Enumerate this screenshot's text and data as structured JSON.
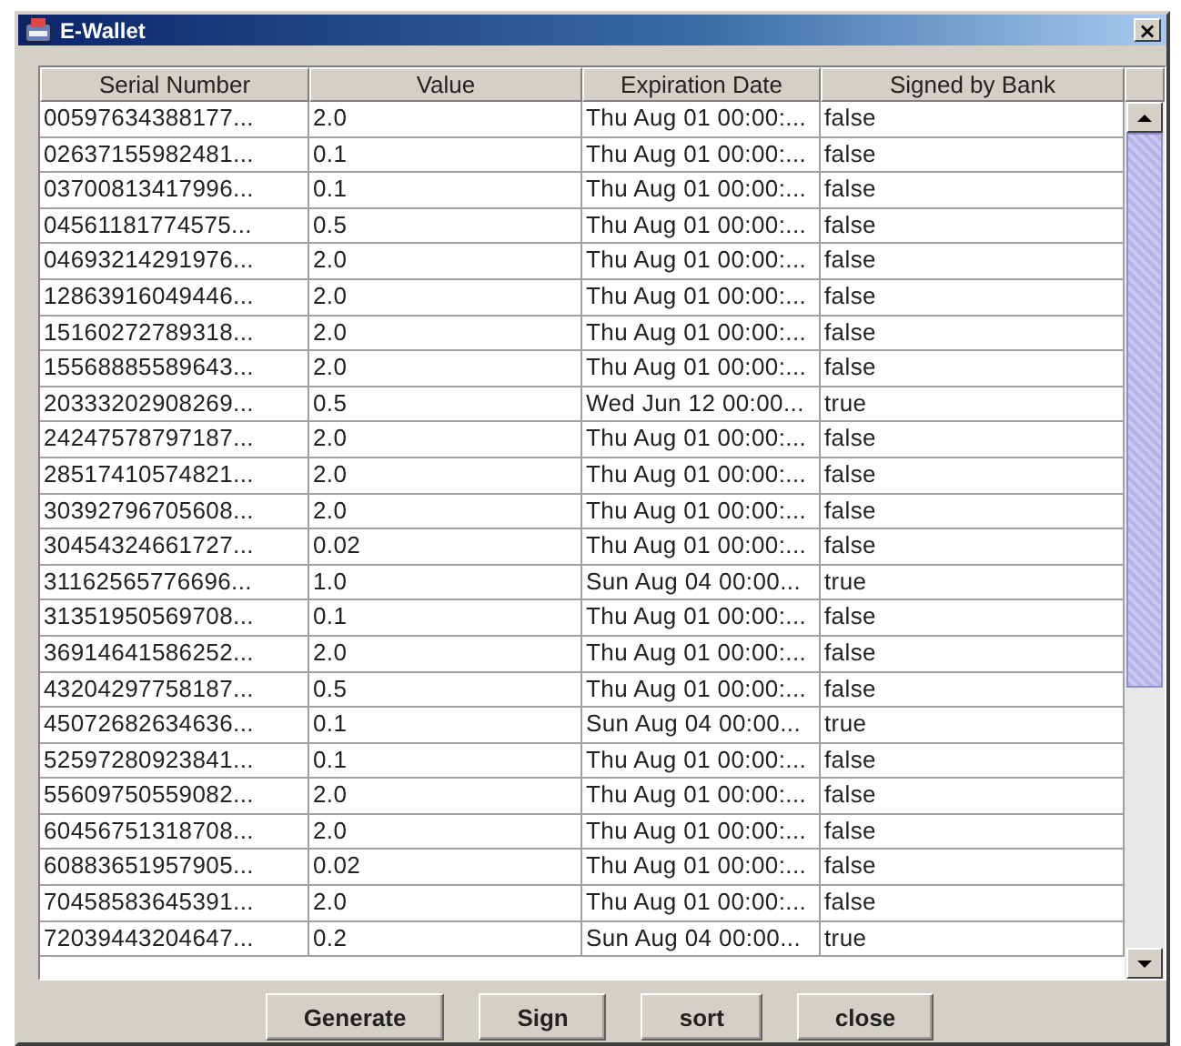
{
  "window": {
    "title": "E-Wallet",
    "close": "×"
  },
  "table": {
    "columns": [
      "Serial Number",
      "Value",
      "Expiration Date",
      "Signed by Bank"
    ],
    "rows": [
      [
        "00597634388177...",
        "2.0",
        "Thu Aug 01 00:00:...",
        "false"
      ],
      [
        "02637155982481...",
        "0.1",
        "Thu Aug 01 00:00:...",
        "false"
      ],
      [
        "03700813417996...",
        "0.1",
        "Thu Aug 01 00:00:...",
        "false"
      ],
      [
        "04561181774575...",
        "0.5",
        "Thu Aug 01 00:00:...",
        "false"
      ],
      [
        "04693214291976...",
        "2.0",
        "Thu Aug 01 00:00:...",
        "false"
      ],
      [
        "12863916049446...",
        "2.0",
        "Thu Aug 01 00:00:...",
        "false"
      ],
      [
        "15160272789318...",
        "2.0",
        "Thu Aug 01 00:00:...",
        "false"
      ],
      [
        "15568885589643...",
        "2.0",
        "Thu Aug 01 00:00:...",
        "false"
      ],
      [
        "20333202908269...",
        "0.5",
        "Wed Jun 12 00:00...",
        "true"
      ],
      [
        "24247578797187...",
        "2.0",
        "Thu Aug 01 00:00:...",
        "false"
      ],
      [
        "28517410574821...",
        "2.0",
        "Thu Aug 01 00:00:...",
        "false"
      ],
      [
        "30392796705608...",
        "2.0",
        "Thu Aug 01 00:00:...",
        "false"
      ],
      [
        "30454324661727...",
        "0.02",
        "Thu Aug 01 00:00:...",
        "false"
      ],
      [
        "31162565776696...",
        "1.0",
        "Sun Aug 04 00:00...",
        "true"
      ],
      [
        "31351950569708...",
        "0.1",
        "Thu Aug 01 00:00:...",
        "false"
      ],
      [
        "36914641586252...",
        "2.0",
        "Thu Aug 01 00:00:...",
        "false"
      ],
      [
        "43204297758187...",
        "0.5",
        "Thu Aug 01 00:00:...",
        "false"
      ],
      [
        "45072682634636...",
        "0.1",
        "Sun Aug 04 00:00...",
        "true"
      ],
      [
        "52597280923841...",
        "0.1",
        "Thu Aug 01 00:00:...",
        "false"
      ],
      [
        "55609750559082...",
        "2.0",
        "Thu Aug 01 00:00:...",
        "false"
      ],
      [
        "60456751318708...",
        "2.0",
        "Thu Aug 01 00:00:...",
        "false"
      ],
      [
        "60883651957905...",
        "0.02",
        "Thu Aug 01 00:00:...",
        "false"
      ],
      [
        "70458583645391...",
        "2.0",
        "Thu Aug 01 00:00:...",
        "false"
      ],
      [
        "72039443204647...",
        "0.2",
        "Sun Aug 04 00:00...",
        "true"
      ]
    ]
  },
  "buttons": [
    "Generate",
    "Sign",
    "sort",
    "close"
  ]
}
